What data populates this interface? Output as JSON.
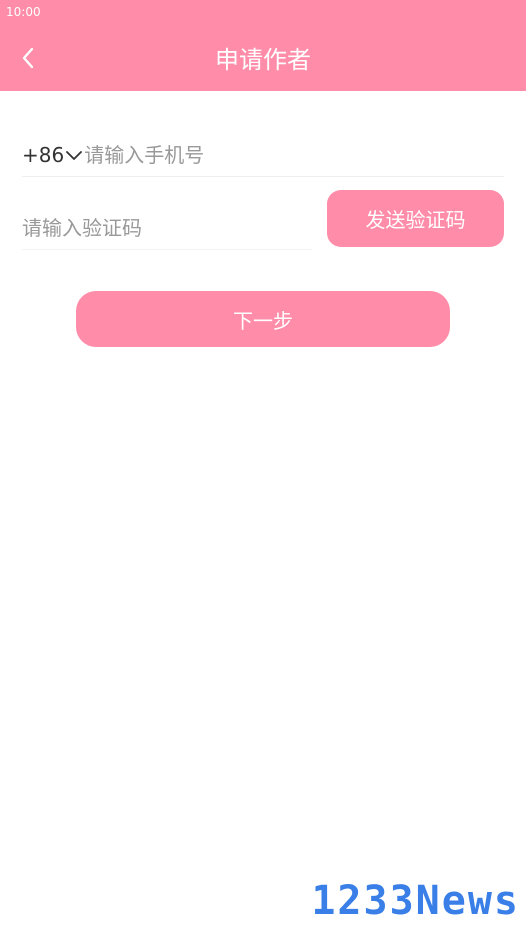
{
  "status_bar": {
    "time": "10:00"
  },
  "header": {
    "title": "申请作者",
    "back_icon": "chevron-left-icon"
  },
  "form": {
    "country_code": "+86",
    "country_code_icon": "chevron-down-icon",
    "phone_placeholder": "请输入手机号",
    "phone_value": "",
    "code_placeholder": "请输入验证码",
    "code_value": "",
    "send_code_label": "发送验证码",
    "next_label": "下一步"
  },
  "watermark": {
    "text": "1233News"
  },
  "colors": {
    "accent": "#ff8ca8",
    "text": "#333333",
    "placeholder": "#999999",
    "watermark": "#3a7fe8"
  }
}
